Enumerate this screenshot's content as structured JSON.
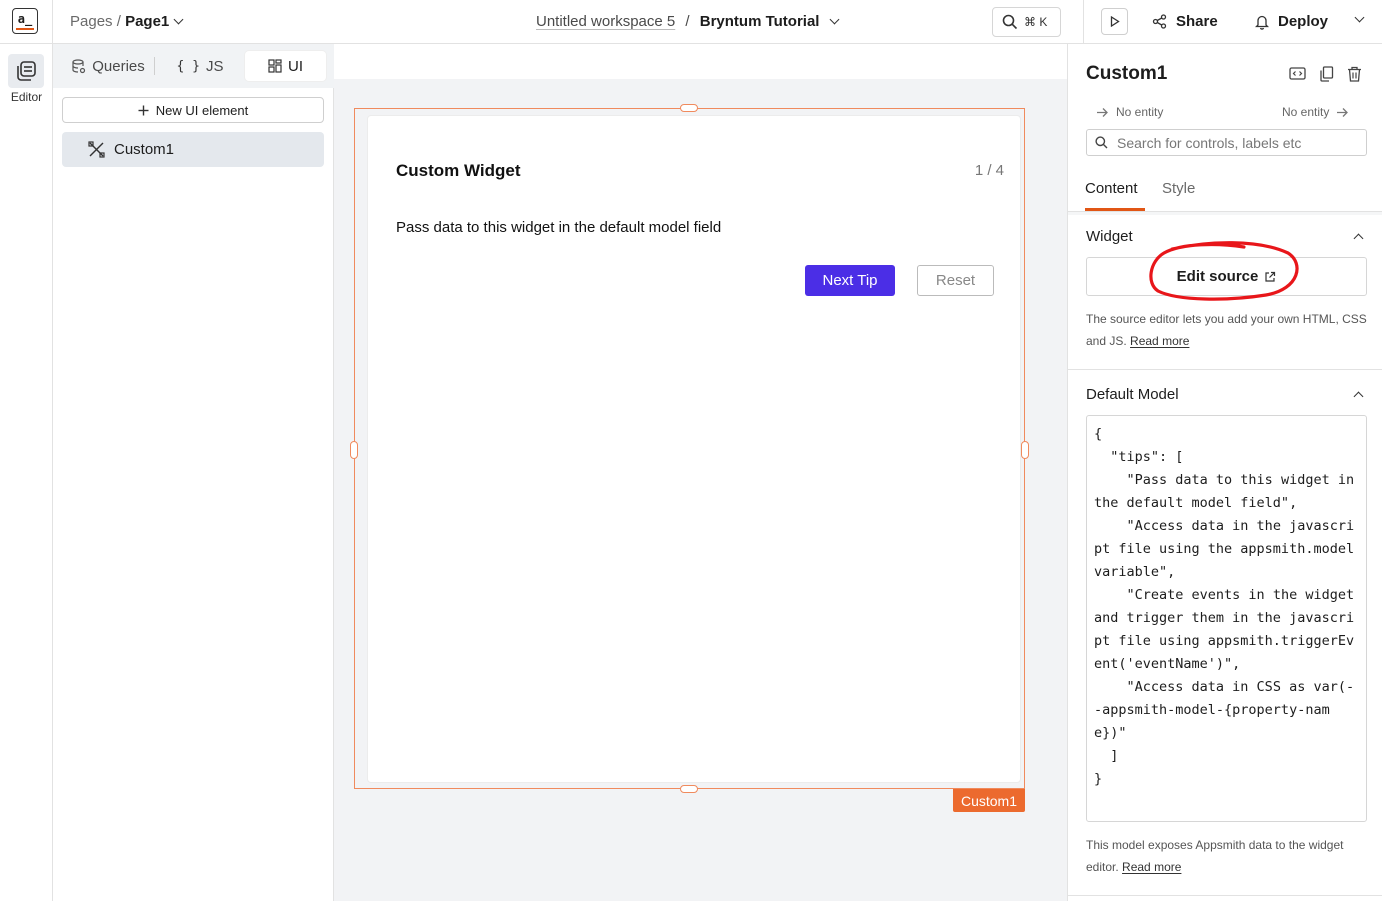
{
  "topbar": {
    "logo_text": "a_",
    "pages_label": "Pages",
    "page_name": "Page1",
    "workspace": "Untitled workspace 5",
    "separator": "/",
    "app_name": "Bryntum Tutorial",
    "shortcut": "⌘ K",
    "share_label": "Share",
    "deploy_label": "Deploy"
  },
  "rail": {
    "editor_label": "Editor"
  },
  "explorer": {
    "tabs": [
      {
        "label": "Queries",
        "icon": "database-icon"
      },
      {
        "label": "JS",
        "icon": "braces-icon",
        "glyph": "{ }"
      },
      {
        "label": "UI",
        "icon": "widgets-icon",
        "active": true
      }
    ],
    "new_ui_label": "New UI element",
    "entities": [
      {
        "label": "Custom1",
        "icon": "custom-widget-icon"
      }
    ]
  },
  "widget": {
    "title": "Custom Widget",
    "counter": "1 / 4",
    "tip": "Pass data to this widget in the default model field",
    "next_label": "Next Tip",
    "reset_label": "Reset",
    "name_tag": "Custom1"
  },
  "props": {
    "title": "Custom1",
    "entity_left": "No entity",
    "entity_right": "No entity",
    "search_placeholder": "Search for controls, labels etc",
    "tabs": [
      {
        "label": "Content",
        "active": true
      },
      {
        "label": "Style"
      }
    ],
    "widget_section": {
      "heading": "Widget",
      "edit_source_label": "Edit source",
      "help_text": "The source editor lets you add your own HTML, CSS and JS.",
      "read_more": "Read more"
    },
    "model_section": {
      "heading": "Default Model",
      "code": "{\n  \"tips\": [\n    \"Pass data to this widget in the default model field\",\n    \"Access data in the javascript file using the appsmith.model variable\",\n    \"Create events in the widget and trigger them in the javascript file using appsmith.triggerEvent('eventName')\",\n    \"Access data in CSS as var(--appsmith-model-{property-name})\"\n  ]\n}",
      "help_text": "This model exposes Appsmith data to the widget editor.",
      "read_more": "Read more"
    }
  },
  "colors": {
    "accent": "#e15615",
    "primary_button": "#4b2ee6",
    "selection": "#f08a5d",
    "annotation": "#e8161a"
  }
}
